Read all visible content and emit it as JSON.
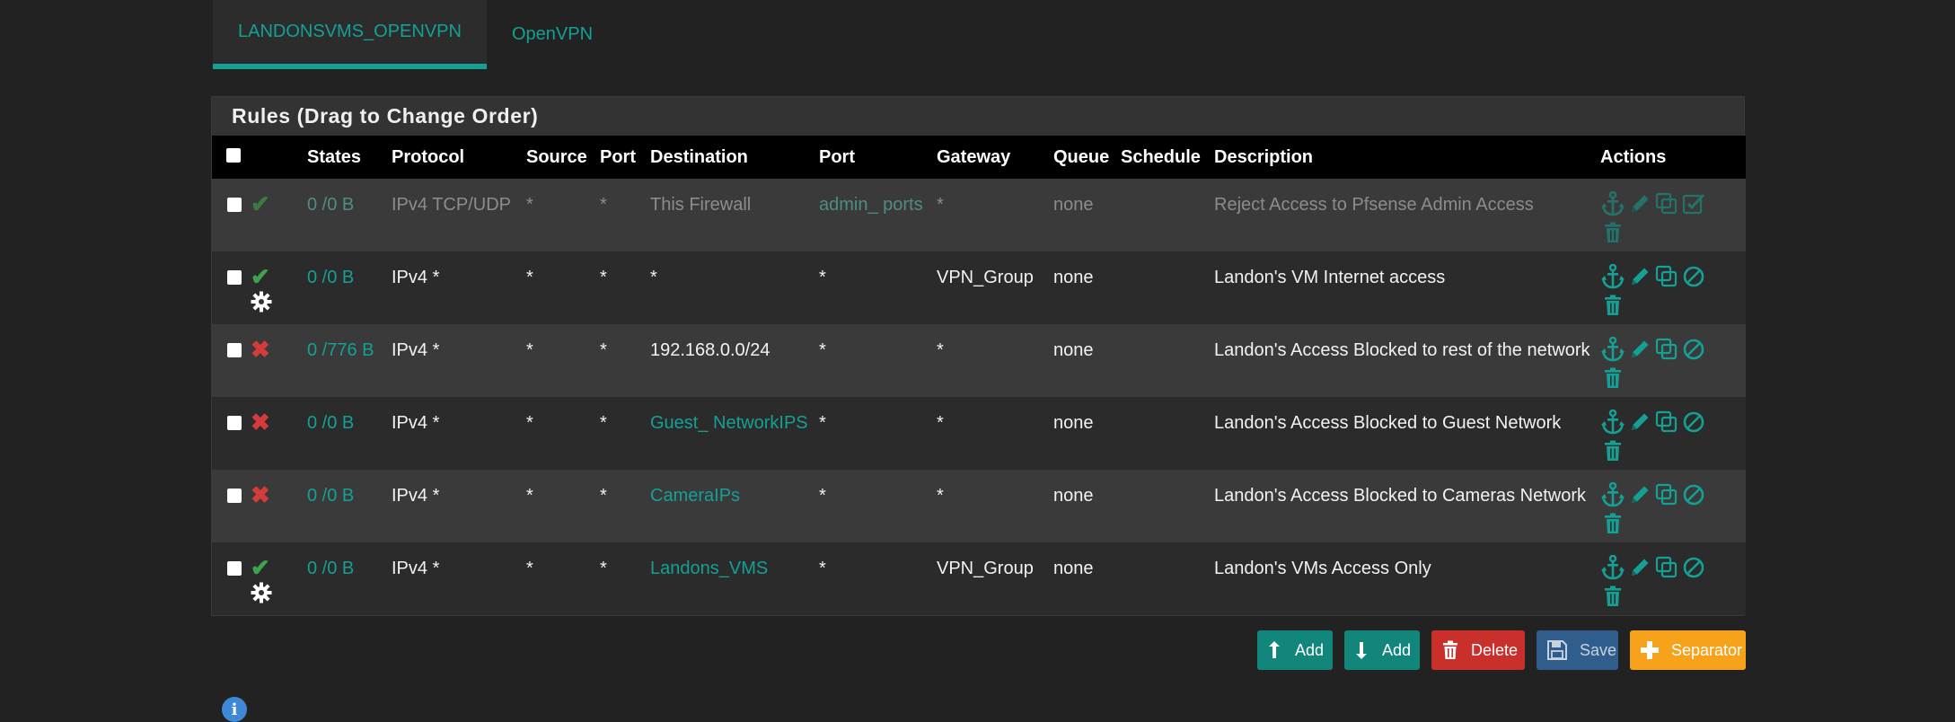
{
  "tabs": [
    {
      "label": "LANDONSVMS_OPENVPN",
      "active": true
    },
    {
      "label": "OpenVPN",
      "active": false
    }
  ],
  "panel": {
    "title": "Rules (Drag to Change Order)"
  },
  "columns": {
    "states": "States",
    "protocol": "Protocol",
    "source": "Source",
    "port": "Port",
    "destination": "Destination",
    "dest_port": "Port",
    "gateway": "Gateway",
    "queue": "Queue",
    "schedule": "Schedule",
    "description": "Description",
    "actions": "Actions"
  },
  "rules": [
    {
      "status": "check",
      "gear": false,
      "disabled": true,
      "states": "0 /0 B",
      "protocol": "IPv4 TCP/UDP",
      "source": "*",
      "port": "*",
      "destination": "This Firewall",
      "destination_link": false,
      "dest_port": "admin_ ports",
      "dest_port_link": true,
      "gateway": "*",
      "queue": "none",
      "schedule": "",
      "description": "Reject Access to Pfsense Admin Access",
      "toggle": "enable-icon"
    },
    {
      "status": "check",
      "gear": true,
      "disabled": false,
      "states": "0 /0 B",
      "protocol": "IPv4 *",
      "source": "*",
      "port": "*",
      "destination": "*",
      "destination_link": false,
      "dest_port": "*",
      "dest_port_link": false,
      "gateway": "VPN_Group",
      "queue": "none",
      "schedule": "",
      "description": "Landon's VM Internet access",
      "toggle": "disable-icon"
    },
    {
      "status": "cross",
      "gear": false,
      "disabled": false,
      "states": "0 /776 B",
      "protocol": "IPv4 *",
      "source": "*",
      "port": "*",
      "destination": "192.168.0.0/24",
      "destination_link": false,
      "dest_port": "*",
      "dest_port_link": false,
      "gateway": "*",
      "queue": "none",
      "schedule": "",
      "description": "Landon's Access Blocked to rest of the network",
      "toggle": "disable-icon"
    },
    {
      "status": "cross",
      "gear": false,
      "disabled": false,
      "states": "0 /0 B",
      "protocol": "IPv4 *",
      "source": "*",
      "port": "*",
      "destination": "Guest_ NetworkIPS",
      "destination_link": true,
      "dest_port": "*",
      "dest_port_link": false,
      "gateway": "*",
      "queue": "none",
      "schedule": "",
      "description": "Landon's Access Blocked to Guest Network",
      "toggle": "disable-icon"
    },
    {
      "status": "cross",
      "gear": false,
      "disabled": false,
      "states": "0 /0 B",
      "protocol": "IPv4 *",
      "source": "*",
      "port": "*",
      "destination": "CameraIPs",
      "destination_link": true,
      "dest_port": "*",
      "dest_port_link": false,
      "gateway": "*",
      "queue": "none",
      "schedule": "",
      "description": "Landon's Access Blocked to Cameras Network",
      "toggle": "disable-icon"
    },
    {
      "status": "check",
      "gear": true,
      "disabled": false,
      "states": "0 /0 B",
      "protocol": "IPv4 *",
      "source": "*",
      "port": "*",
      "destination": "Landons_VMS",
      "destination_link": true,
      "dest_port": "*",
      "dest_port_link": false,
      "gateway": "VPN_Group",
      "queue": "none",
      "schedule": "",
      "description": "Landon's VMs Access Only",
      "toggle": "disable-icon"
    }
  ],
  "buttons": {
    "add_top": "Add",
    "add_bottom": "Add",
    "delete": "Delete",
    "save": "Save",
    "separator": "Separator"
  },
  "colors": {
    "accent": "#14a195",
    "pass": "#3fa34d",
    "block": "#d63b3b",
    "danger": "#c9302c",
    "warning": "#f7a21b",
    "save": "#2f5e8c",
    "info": "#3d89d6"
  },
  "icons": {
    "pass": "check-icon",
    "block": "cross-icon",
    "schedule": "gear-icon",
    "anchor": "anchor-icon",
    "edit": "pencil-icon",
    "copy": "copy-icon",
    "delete": "trash-icon",
    "info": "info-icon"
  }
}
